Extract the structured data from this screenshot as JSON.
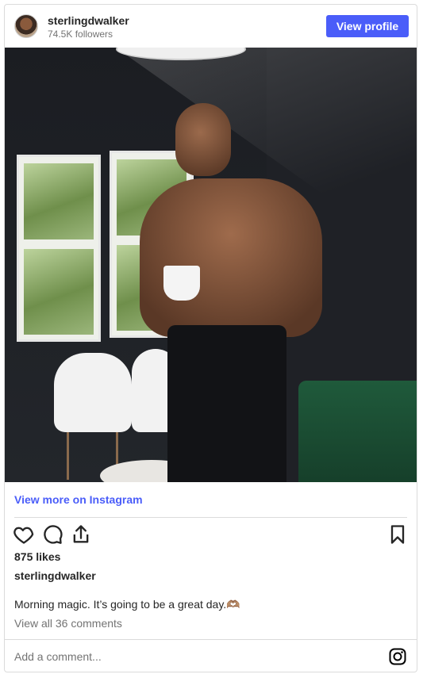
{
  "header": {
    "username": "sterlingdwalker",
    "followers": "74.5K followers",
    "view_profile": "View profile"
  },
  "post": {
    "view_more": "View more on Instagram",
    "likes": "875 likes",
    "author": "sterlingdwalker",
    "caption": "Morning magic. It’s going to be a great day.🫶🏽",
    "comments": "View all 36 comments",
    "add_comment_placeholder": "Add a comment..."
  },
  "colors": {
    "accent": "#4a5df9",
    "text": "#262626",
    "muted": "#737373",
    "border": "#dbdbdb"
  },
  "icons": [
    "heart-icon",
    "comment-icon",
    "share-icon",
    "bookmark-icon",
    "instagram-icon"
  ]
}
